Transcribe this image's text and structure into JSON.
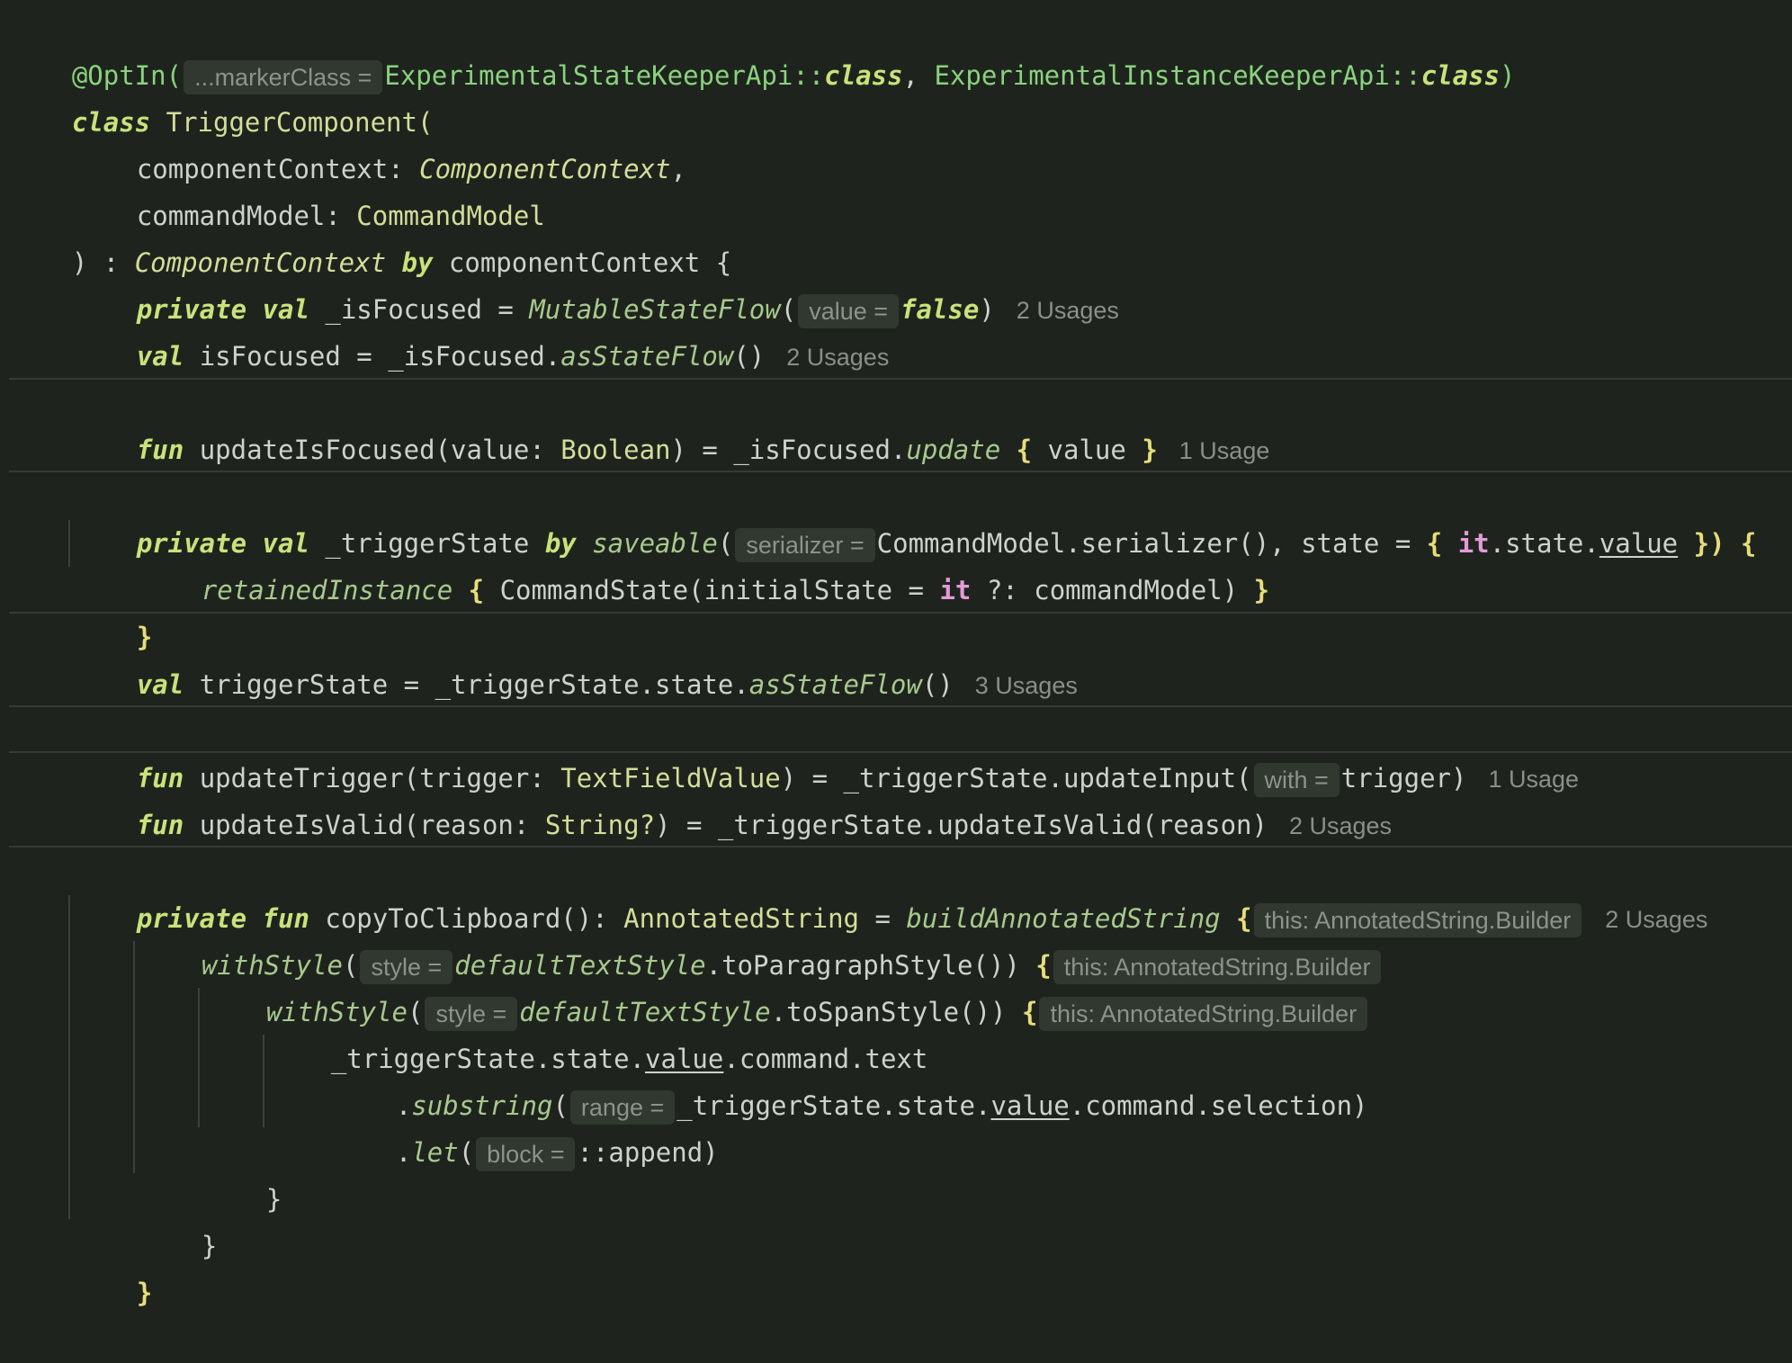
{
  "editor": {
    "background": "#1e241d",
    "language": "Kotlin",
    "lines": {
      "l1_at": "@OptIn(",
      "l1_hint": "...markerClass =",
      "l1_api1": "ExperimentalStateKeeperApi",
      "l1_cc": "::",
      "l1_class": "class",
      "l1_comma": ", ",
      "l1_api2": "ExperimentalInstanceKeeperApi",
      "l1_close": ")",
      "l2_class": "class",
      "l2_name": " TriggerComponent(",
      "l3_param": "componentContext: ",
      "l3_type": "ComponentContext",
      "l3_comma": ",",
      "l4_param": "commandModel: ",
      "l4_type": "CommandModel",
      "l5_open": ") : ",
      "l5_type": "ComponentContext",
      "l5_by": "by",
      "l5_rest": " componentContext {",
      "l6_private": "private",
      "l6_val": "val",
      "l6_rest": " _isFocused = ",
      "l6_fn": "MutableStateFlow",
      "l6_paren": "(",
      "l6_hint": "value =",
      "l6_false": "false",
      "l6_close": ")",
      "l6_usages": "2 Usages",
      "l7_val": "val",
      "l7_rest": " isFocused = _isFocused.",
      "l7_fn": "asStateFlow",
      "l7_parens": "()",
      "l7_usages": "2 Usages",
      "l8_fun": "fun",
      "l8_rest": " updateIsFocused(value: ",
      "l8_type": "Boolean",
      "l8_mid": ") = _isFocused.",
      "l8_fn": "update",
      "l8_b1": "{",
      "l8_val": " value ",
      "l8_b2": "}",
      "l8_usages": "1 Usage",
      "l9_private": "private",
      "l9_val": "val",
      "l9_rest": " _triggerState ",
      "l9_by": "by",
      "l9_fn": "saveable",
      "l9_paren": "(",
      "l9_hint": "serializer =",
      "l9_mid": "CommandModel.serializer(), state = ",
      "l9_b1": "{",
      "l9_it": "it",
      "l9_state": ".state.",
      "l9_value": "value",
      "l9_b2": "})",
      "l9_b3": "{",
      "l10_fn": "retainedInstance",
      "l10_b1": "{",
      "l10_mid": " CommandState(initialState = ",
      "l10_it": "it",
      "l10_rest": " ?: commandModel) ",
      "l10_b2": "}",
      "l11_b": "}",
      "l12_val": "val",
      "l12_rest": " triggerState = _triggerState.state.",
      "l12_fn": "asStateFlow",
      "l12_parens": "()",
      "l12_usages": "3 Usages",
      "l13_fun": "fun",
      "l13_rest": " updateTrigger(trigger: ",
      "l13_type": "TextFieldValue",
      "l13_mid": ") = _triggerState.updateInput(",
      "l13_hint": "with =",
      "l13_end": "trigger)",
      "l13_usages": "1 Usage",
      "l14_fun": "fun",
      "l14_rest": " updateIsValid(reason: ",
      "l14_type": "String?",
      "l14_end": ") = _triggerState.updateIsValid(reason)",
      "l14_usages": "2 Usages",
      "l15_private": "private",
      "l15_fun": "fun",
      "l15_rest": " copyToClipboard(): ",
      "l15_type": "AnnotatedString",
      "l15_eq": " = ",
      "l15_fn": "buildAnnotatedString",
      "l15_b": "{",
      "l15_hint": "this: AnnotatedString.Builder",
      "l15_usages": "2 Usages",
      "l16_fn": "withStyle",
      "l16_paren": "(",
      "l16_hint": "style =",
      "l16_arg": "defaultTextStyle",
      "l16_rest": ".toParagraphStyle()) ",
      "l16_b": "{",
      "l16_hint2": "this: AnnotatedString.Builder",
      "l17_fn": "withStyle",
      "l17_paren": "(",
      "l17_hint": "style =",
      "l17_arg": "defaultTextStyle",
      "l17_rest": ".toSpanStyle()) ",
      "l17_b": "{",
      "l17_hint2": "this: AnnotatedString.Builder",
      "l18_pre": "_triggerState.state.",
      "l18_value": "value",
      "l18_rest": ".command.text",
      "l19_dot": ".",
      "l19_fn": "substring",
      "l19_paren": "(",
      "l19_hint": "range =",
      "l19_mid": "_triggerState.state.",
      "l19_value": "value",
      "l19_rest": ".command.selection)",
      "l20_dot": ".",
      "l20_fn": "let",
      "l20_paren": "(",
      "l20_hint": "block =",
      "l20_rest": "::append)",
      "l21_b": "}",
      "l22_b": "}",
      "l23_b": "}"
    }
  }
}
